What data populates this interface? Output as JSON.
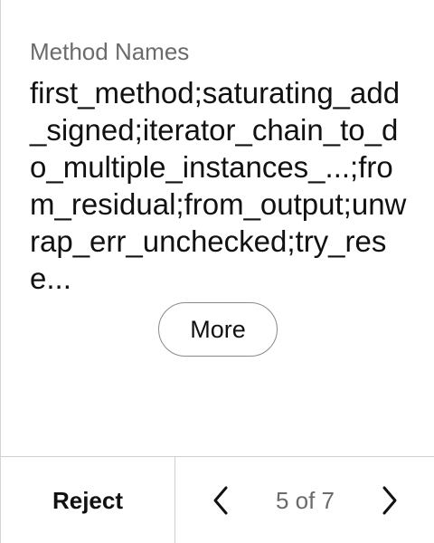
{
  "field": {
    "label": "Method Names",
    "value": "first_method;saturating_add_signed;iterator_chain_to_do_multiple_instances_...;from_residual;from_output;unwrap_err_unchecked;try_rese..."
  },
  "actions": {
    "more_label": "More",
    "reject_label": "Reject"
  },
  "pagination": {
    "indicator": "5 of 7",
    "prev_icon": "chevron-left-icon",
    "next_icon": "chevron-right-icon"
  },
  "colors": {
    "text": "#111111",
    "muted": "#6b6b6b",
    "border": "#cfcfcf"
  }
}
